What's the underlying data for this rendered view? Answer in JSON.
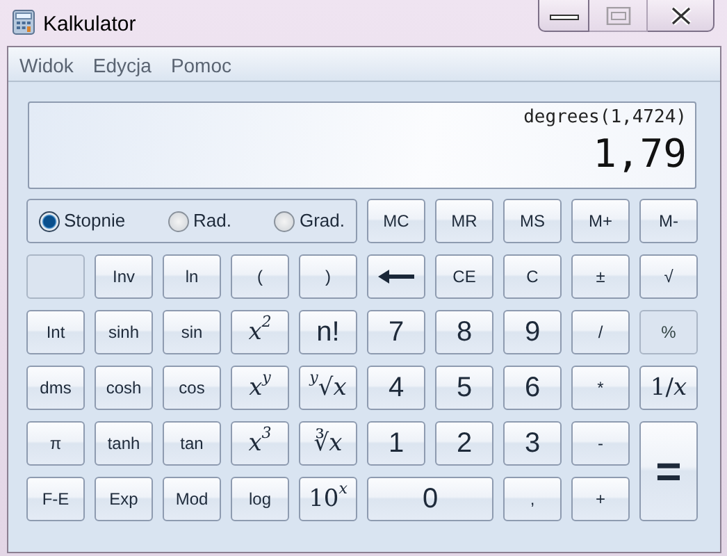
{
  "window": {
    "title": "Kalkulator",
    "buttons": [
      {
        "kind": "minimize",
        "disabled": false
      },
      {
        "kind": "maximize",
        "disabled": true
      },
      {
        "kind": "close",
        "disabled": false
      }
    ]
  },
  "menu": [
    "Widok",
    "Edycja",
    "Pomoc"
  ],
  "display": {
    "expression": "degrees(1,4724)",
    "value": "1,79"
  },
  "angle_modes": [
    {
      "label": "Stopnie",
      "selected": true
    },
    {
      "label": "Rad.",
      "selected": false
    },
    {
      "label": "Grad.",
      "selected": false
    }
  ],
  "memory_buttons": [
    "MC",
    "MR",
    "MS",
    "M+",
    "M-"
  ],
  "keys": [
    {
      "kind": "blank",
      "disabled": true
    },
    {
      "kind": "key",
      "label": "Inv",
      "disabled": false
    },
    {
      "kind": "key",
      "label": "ln",
      "disabled": false
    },
    {
      "kind": "key",
      "label": "(",
      "disabled": false
    },
    {
      "kind": "key",
      "label": ")",
      "disabled": false
    },
    {
      "kind": "backspace",
      "disabled": false
    },
    {
      "kind": "key",
      "label": "CE",
      "disabled": false
    },
    {
      "kind": "key",
      "label": "C",
      "disabled": false
    },
    {
      "kind": "key",
      "label": "±",
      "disabled": false
    },
    {
      "kind": "key",
      "label": "√",
      "disabled": false
    },
    {
      "kind": "key",
      "label": "Int",
      "disabled": false
    },
    {
      "kind": "key",
      "label": "sinh",
      "disabled": false
    },
    {
      "kind": "key",
      "label": "sin",
      "disabled": false
    },
    {
      "kind": "math",
      "label": "*x*$^{2}$",
      "disabled": false
    },
    {
      "kind": "digit",
      "label": "n!",
      "disabled": false
    },
    {
      "kind": "digit",
      "label": "7",
      "disabled": false
    },
    {
      "kind": "digit",
      "label": "8",
      "disabled": false
    },
    {
      "kind": "digit",
      "label": "9",
      "disabled": false
    },
    {
      "kind": "key",
      "label": "/",
      "disabled": false
    },
    {
      "kind": "key",
      "label": "%",
      "disabled": true
    },
    {
      "kind": "key",
      "label": "dms",
      "disabled": false
    },
    {
      "kind": "key",
      "label": "cosh",
      "disabled": false
    },
    {
      "kind": "key",
      "label": "cos",
      "disabled": false
    },
    {
      "kind": "math",
      "label": "*x*$^{y}$",
      "disabled": false
    },
    {
      "kind": "math",
      "label": "$^{y}$√*x*",
      "disabled": false
    },
    {
      "kind": "digit",
      "label": "4",
      "disabled": false
    },
    {
      "kind": "digit",
      "label": "5",
      "disabled": false
    },
    {
      "kind": "digit",
      "label": "6",
      "disabled": false
    },
    {
      "kind": "key",
      "label": "*",
      "disabled": false
    },
    {
      "kind": "math",
      "label": "1/*x*",
      "disabled": false
    },
    {
      "kind": "key",
      "label": "π",
      "disabled": false
    },
    {
      "kind": "key",
      "label": "tanh",
      "disabled": false
    },
    {
      "kind": "key",
      "label": "tan",
      "disabled": false
    },
    {
      "kind": "math",
      "label": "*x*$^{3}$",
      "disabled": false
    },
    {
      "kind": "math",
      "label": "∛*x*",
      "disabled": false
    },
    {
      "kind": "digit",
      "label": "1",
      "disabled": false
    },
    {
      "kind": "digit",
      "label": "2",
      "disabled": false
    },
    {
      "kind": "digit",
      "label": "3",
      "disabled": false
    },
    {
      "kind": "key",
      "label": "-",
      "disabled": false
    },
    {
      "kind": "tall",
      "label": "=",
      "disabled": false
    },
    {
      "kind": "key",
      "label": "F-E",
      "disabled": false
    },
    {
      "kind": "key",
      "label": "Exp",
      "disabled": false
    },
    {
      "kind": "key",
      "label": "Mod",
      "disabled": false
    },
    {
      "kind": "key",
      "label": "log",
      "disabled": false
    },
    {
      "kind": "math",
      "label": "10$^{x}$",
      "disabled": false
    },
    {
      "kind": "wide",
      "label": "0",
      "disabled": false
    },
    {
      "kind": "key",
      "label": ",",
      "disabled": false
    },
    {
      "kind": "key",
      "label": "+",
      "disabled": false
    }
  ]
}
